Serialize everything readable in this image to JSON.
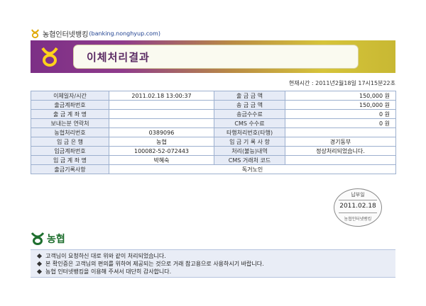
{
  "header": {
    "title": "농협인터넷뱅킹",
    "url": "(banking.nonghyup.com)",
    "logo_icon": "nonghyup-logo-icon"
  },
  "banner": {
    "title": "이체처리결과",
    "emblem_icon": "nonghyup-emblem-icon"
  },
  "current_time": "현재시간 : 2011년2월18일 17시15분22초",
  "table": {
    "rows": [
      [
        "이체일자/시간",
        "2011.02.18 13:00:37",
        "출 금 금 액",
        "150,000 원"
      ],
      [
        "출금계좌번호",
        "",
        "송 금 금 액",
        "150,000 원"
      ],
      [
        "출 금 계 좌 명",
        "",
        "송금수수료",
        "0 원"
      ],
      [
        "보내는분 연락처",
        "",
        "CMS 수수료",
        "0 원"
      ],
      [
        "농협처리번호",
        "0389096",
        "타행처리번호(타행)",
        ""
      ],
      [
        "입 금 은 행",
        "농협",
        "입 금 기 록 사 항",
        "경기동부"
      ],
      [
        "입금계좌번호",
        "100082-52-072443",
        "처리(불능)내역",
        "정상처리되었습니다."
      ],
      [
        "입 금 계 좌 명",
        "박혜숙",
        "CMS 거래처 코드",
        ""
      ]
    ],
    "last_row": {
      "label": "출금기록사항",
      "value": "독거노인"
    }
  },
  "stamp": {
    "top": "납부일",
    "date": "2011.02.18",
    "name": "농협인터넷뱅킹"
  },
  "footer": {
    "logo_text": "농협",
    "logo_icon": "nonghyup-logo-icon",
    "notes": [
      "고객님이 요청하신 대로 위와 같이 처리되었습니다.",
      "본 확인증은 고객님의 편의를 위하여 제공되는 것으로 거래 참고용으로 사용하시기 바랍니다.",
      "농협 인터넷뱅킹을 이용해 주셔서 대단히 감사합니다."
    ]
  },
  "colors": {
    "label_bg": "#e6ebf6",
    "border": "#9db0cf",
    "banner_purple": "#7c2f86",
    "banner_gold": "#d6c43a",
    "brand_green": "#1e6f2e"
  }
}
